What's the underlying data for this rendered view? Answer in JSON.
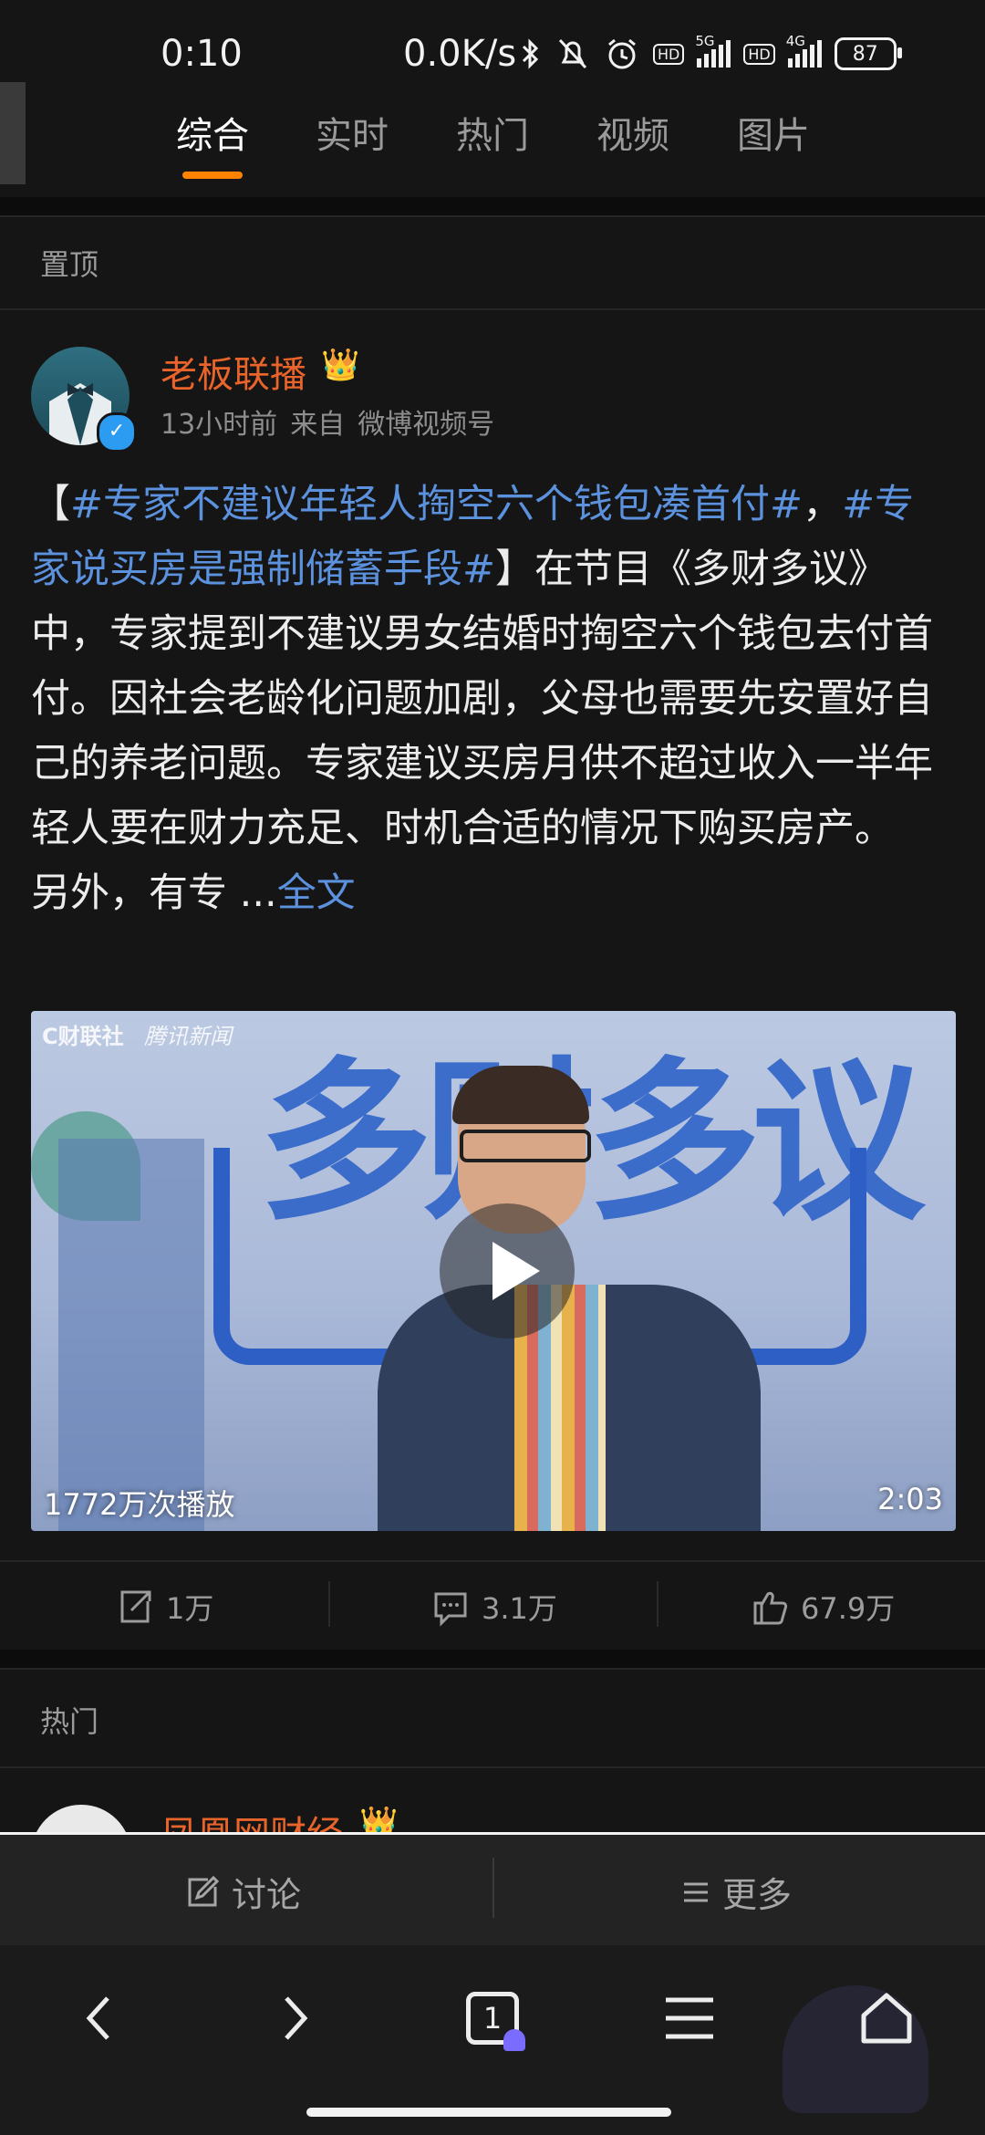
{
  "status_bar": {
    "time": "0:10",
    "net_speed": "0.0K/s",
    "battery": "87",
    "signal1_label": "5G",
    "signal2_label": "4G",
    "hd_label": "HD",
    "icons": [
      "bluetooth-icon",
      "mute-icon",
      "alarm-icon"
    ]
  },
  "tabs": [
    "综合",
    "实时",
    "热门",
    "视频",
    "图片"
  ],
  "active_tab": "综合",
  "accent_color": "#ff8200",
  "pinned": {
    "section_label": "置顶",
    "post": {
      "author": "老板联播",
      "time": "13小时前",
      "source_prefix": "来自",
      "source": "微博视频号",
      "text": {
        "open_bracket": "【",
        "tag1": "#专家不建议年轻人掏空六个钱包凑首付#",
        "comma": "，",
        "tag2": "#专家说买房是强制储蓄手段#",
        "body": "】在节目《多财多议》中，专家提到不建议男女结婚时掏空六个钱包去付首付。因社会老龄化问题加剧，父母也需要先安置好自己的养老问题。专家建议买房月供不超过收入一半年轻人要在财力充足、时机合适的情况下购买房产。",
        "tail": "另外，有专 ...",
        "more": "全文"
      },
      "video": {
        "watermark1": "C财联社",
        "watermark2": "腾讯新闻",
        "plays": "1772万次播放",
        "duration": "2:03",
        "stage_text": "多财多议"
      },
      "actions": {
        "reposts": "1万",
        "comments": "3.1万",
        "likes": "67.9万"
      }
    }
  },
  "hot": {
    "section_label": "热门",
    "peek_author": "凤凰网财经"
  },
  "bottom_bar": {
    "discuss": "讨论",
    "more": "更多"
  },
  "browser_nav": {
    "tab_count": "1"
  }
}
